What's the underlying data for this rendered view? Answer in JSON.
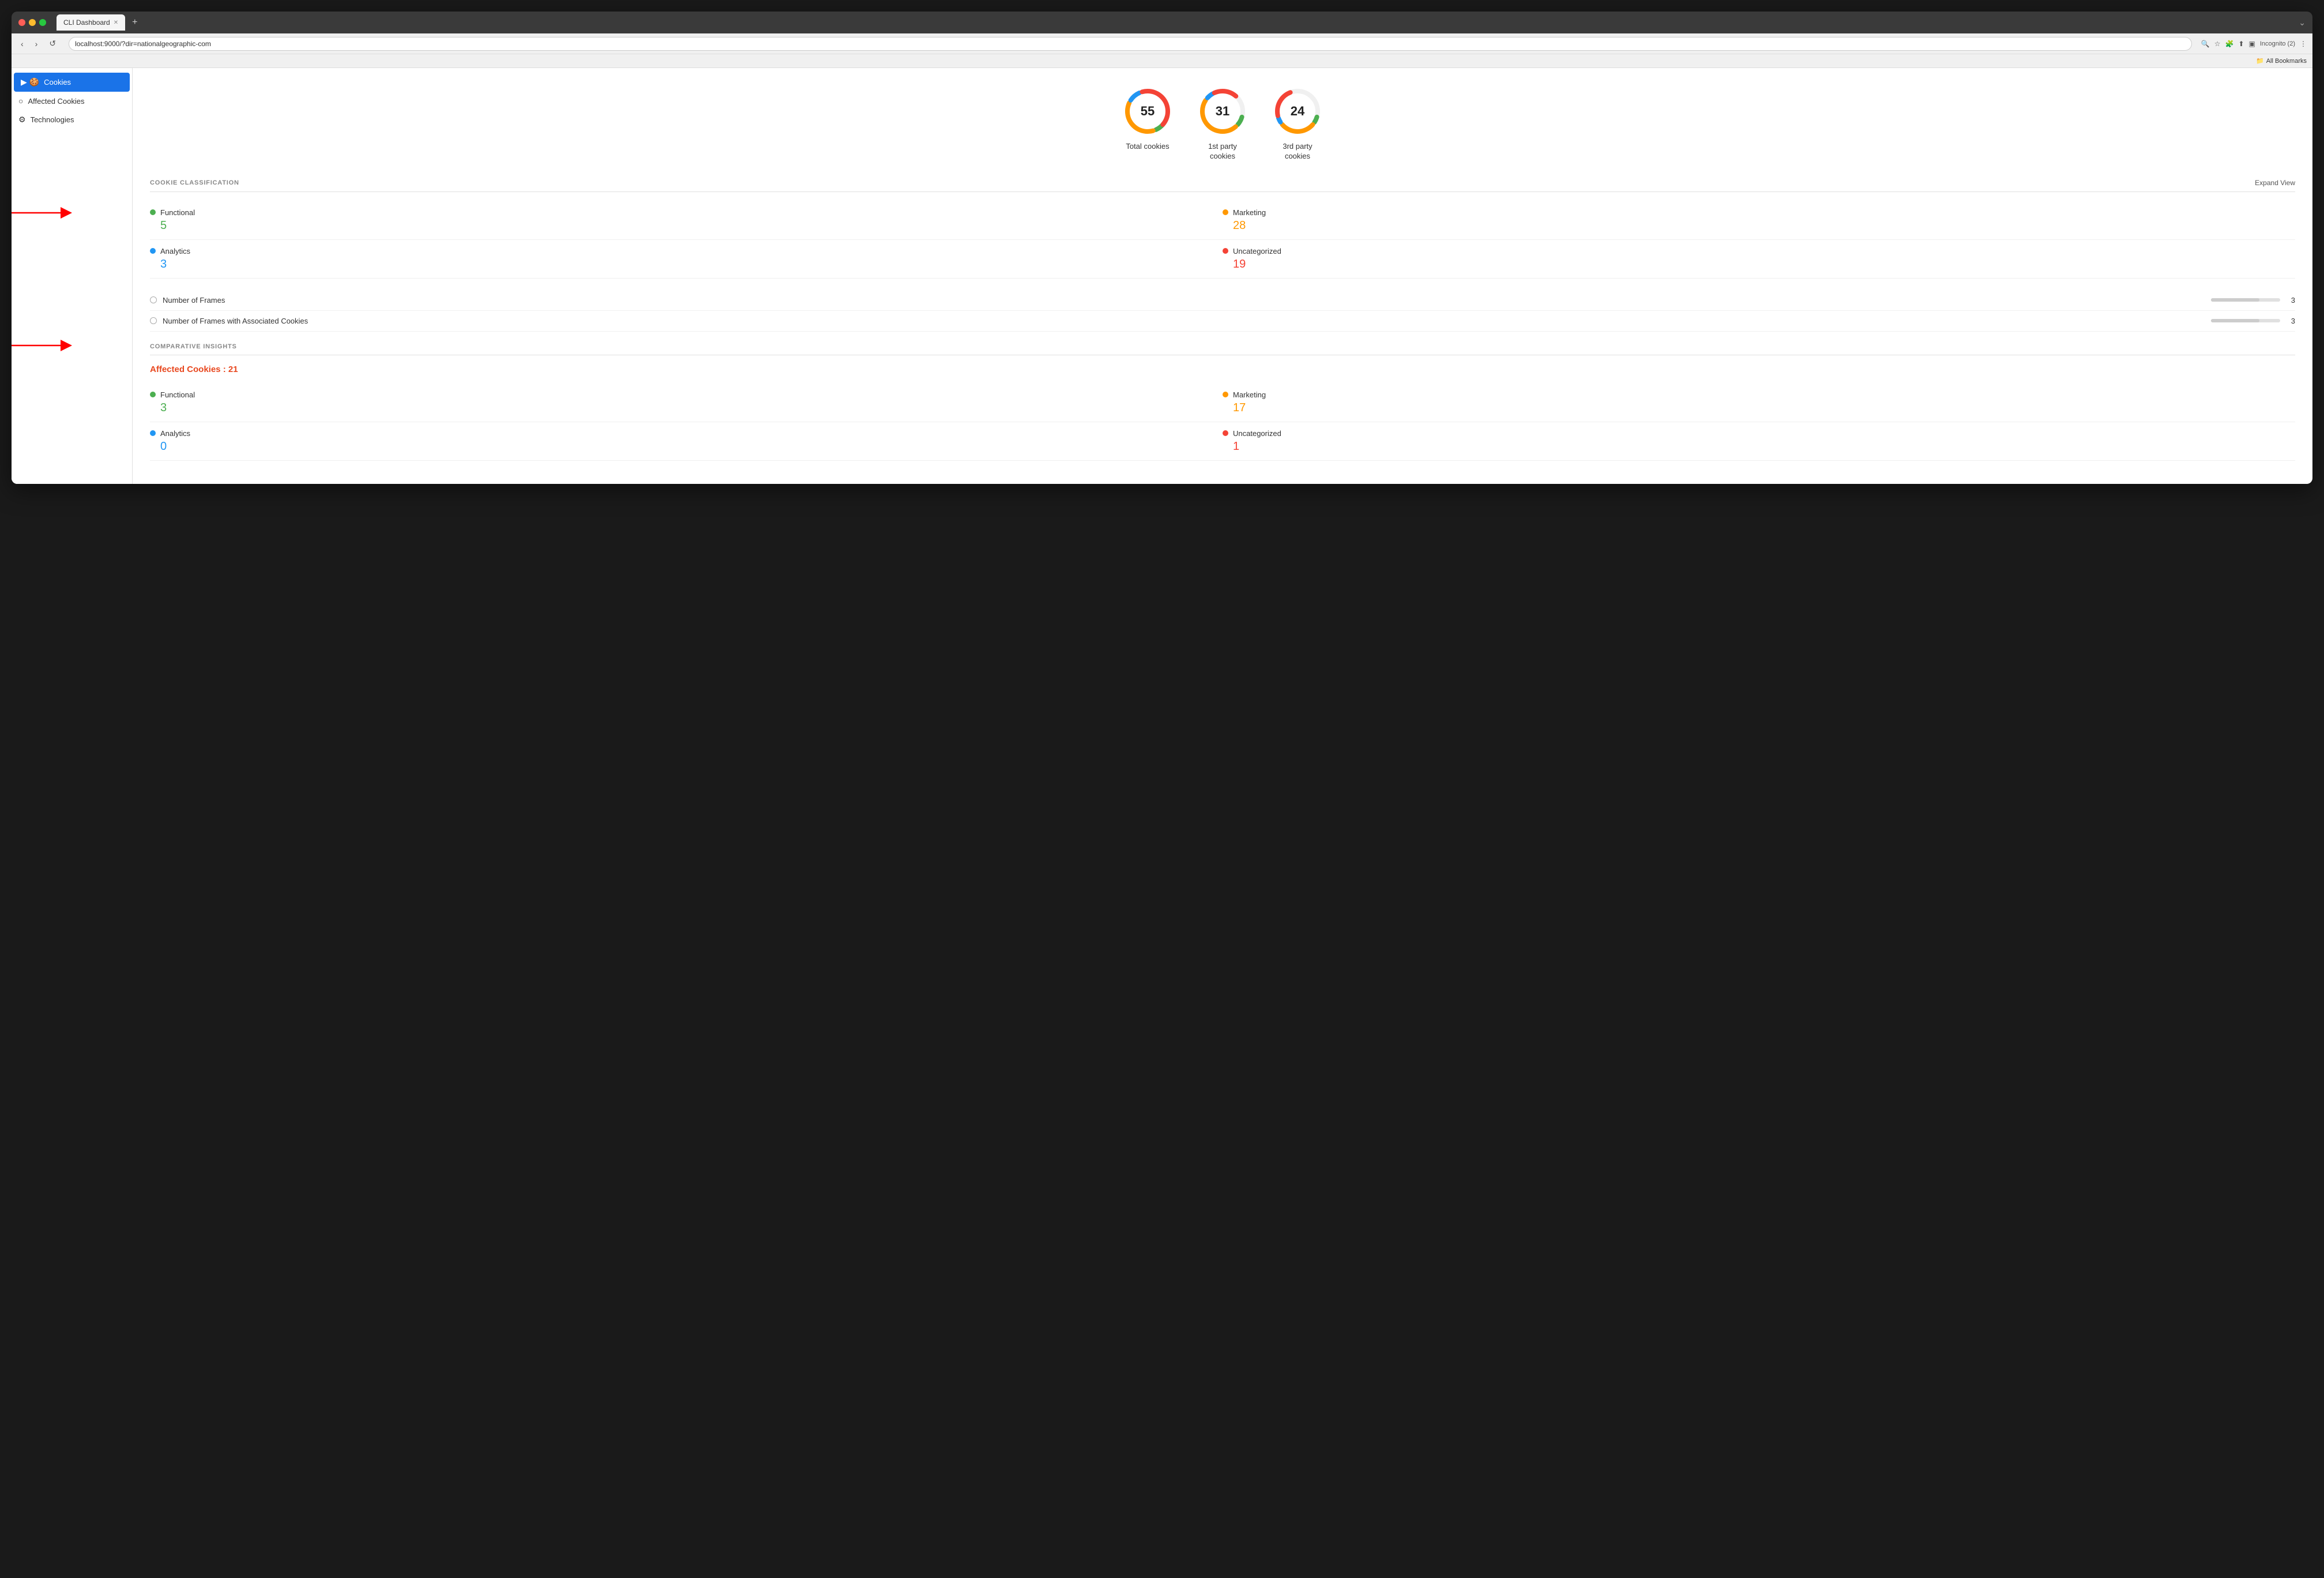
{
  "browser": {
    "tab_title": "CLI Dashboard",
    "url": "localhost:9000/?dir=nationalgeographic-com",
    "bookmarks": "All Bookmarks",
    "incognito_label": "Incognito (2)",
    "new_tab_label": "+"
  },
  "sidebar": {
    "items": [
      {
        "id": "cookies",
        "label": "Cookies",
        "icon": "🍪",
        "active": true
      },
      {
        "id": "affected-cookies",
        "label": "Affected Cookies",
        "icon": "○"
      },
      {
        "id": "technologies",
        "label": "Technologies",
        "icon": "⚙"
      }
    ]
  },
  "stats": {
    "total": {
      "value": "55",
      "label": "Total\ncookies"
    },
    "first_party": {
      "value": "31",
      "label": "1st party\ncookies"
    },
    "third_party": {
      "value": "24",
      "label": "3rd party\ncookies"
    }
  },
  "cookie_classification": {
    "title": "COOKIE CLASSIFICATION",
    "expand_label": "Expand View",
    "items": [
      {
        "id": "functional",
        "label": "Functional",
        "count": "5",
        "color_class": "green",
        "dot_class": "green",
        "count_class": "count-green",
        "col": 0
      },
      {
        "id": "marketing",
        "label": "Marketing",
        "count": "28",
        "color_class": "orange",
        "dot_class": "orange",
        "count_class": "count-orange",
        "col": 1
      },
      {
        "id": "analytics",
        "label": "Analytics",
        "count": "3",
        "color_class": "blue",
        "dot_class": "blue",
        "count_class": "count-blue",
        "col": 0
      },
      {
        "id": "uncategorized",
        "label": "Uncategorized",
        "count": "19",
        "color_class": "red",
        "dot_class": "red",
        "count_class": "count-red",
        "col": 1
      }
    ],
    "frames": [
      {
        "id": "number-of-frames",
        "label": "Number of Frames",
        "bar_pct": 70,
        "count": "3"
      },
      {
        "id": "frames-with-cookies",
        "label": "Number of Frames with Associated Cookies",
        "bar_pct": 70,
        "count": "3"
      }
    ]
  },
  "comparative_insights": {
    "title": "COMPARATIVE INSIGHTS",
    "affected_label": "Affected Cookies : 21",
    "items": [
      {
        "id": "functional",
        "label": "Functional",
        "count": "3",
        "dot_class": "green",
        "count_class": "count-green"
      },
      {
        "id": "marketing",
        "label": "Marketing",
        "count": "17",
        "dot_class": "orange",
        "count_class": "count-orange"
      },
      {
        "id": "analytics",
        "label": "Analytics",
        "count": "0",
        "dot_class": "blue",
        "count_class": "count-blue"
      },
      {
        "id": "uncategorized",
        "label": "Uncategorized",
        "count": "1",
        "dot_class": "red",
        "count_class": "count-red"
      }
    ]
  }
}
